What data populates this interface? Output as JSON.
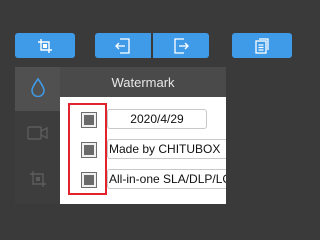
{
  "toolbar": {
    "buttons": [
      {
        "name": "crop",
        "icon": "crop-icon"
      },
      {
        "name": "import",
        "icon": "import-icon"
      },
      {
        "name": "export",
        "icon": "export-icon"
      },
      {
        "name": "document",
        "icon": "document-icon"
      }
    ]
  },
  "sidebar": {
    "items": [
      {
        "icon": "water-drop-icon",
        "active": true
      },
      {
        "icon": "video-camera-icon",
        "active": false
      },
      {
        "icon": "crop-frame-icon",
        "active": false
      }
    ]
  },
  "panel": {
    "title": "Watermark",
    "rows": [
      {
        "checked": true,
        "value": "2020/4/29"
      },
      {
        "checked": true,
        "value": "Made by CHITUBOX"
      },
      {
        "checked": true,
        "value": "All-in-one SLA/DLP/LCD"
      }
    ]
  },
  "colors": {
    "accent": "#3f9be8",
    "highlight": "#e0232c",
    "background": "#3a3a3a"
  }
}
